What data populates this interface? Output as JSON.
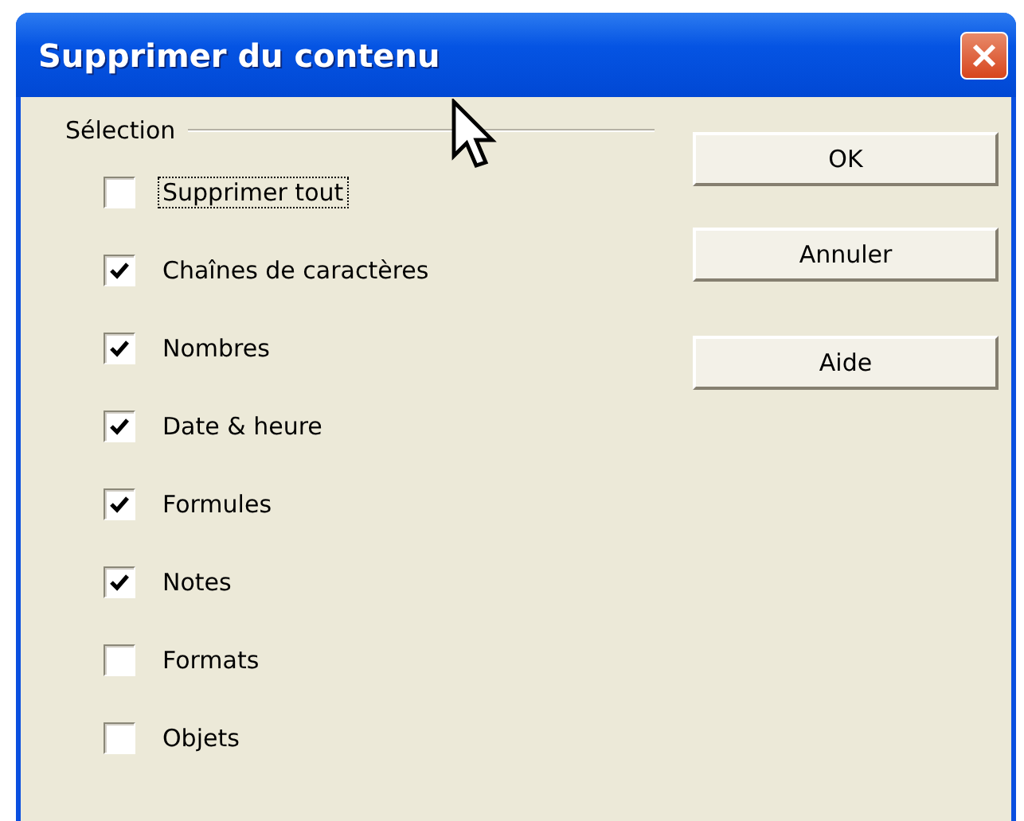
{
  "window": {
    "title": "Supprimer du contenu"
  },
  "group": {
    "label": "Sélection"
  },
  "options": [
    {
      "label": "Supprimer tout",
      "checked": false,
      "focused": true
    },
    {
      "label": "Chaînes de caractères",
      "checked": true,
      "focused": false
    },
    {
      "label": "Nombres",
      "checked": true,
      "focused": false
    },
    {
      "label": "Date & heure",
      "checked": true,
      "focused": false
    },
    {
      "label": "Formules",
      "checked": true,
      "focused": false
    },
    {
      "label": "Notes",
      "checked": true,
      "focused": false
    },
    {
      "label": "Formats",
      "checked": false,
      "focused": false
    },
    {
      "label": "Objets",
      "checked": false,
      "focused": false
    }
  ],
  "buttons": [
    "OK",
    "Annuler",
    "Aide"
  ]
}
